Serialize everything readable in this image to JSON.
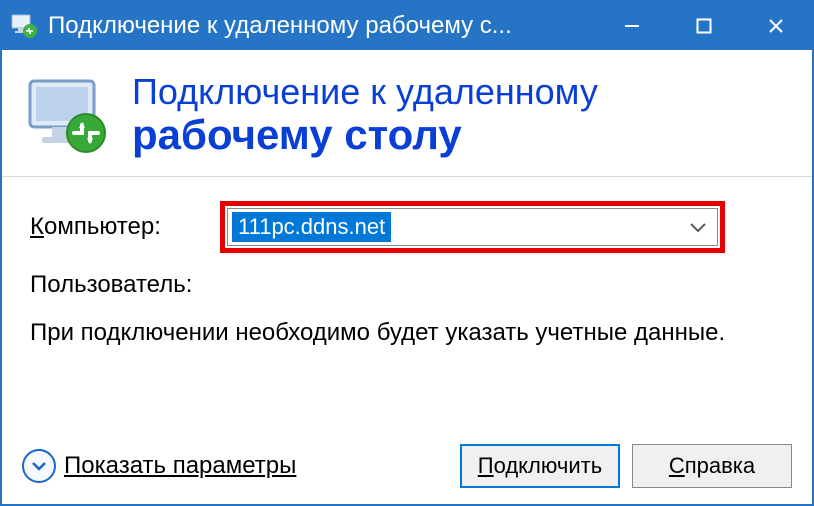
{
  "titlebar": {
    "title": "Подключение к удаленному рабочему с..."
  },
  "header": {
    "line1": "Подключение к удаленному",
    "line2": "рабочему столу"
  },
  "form": {
    "computer_label_pre": "К",
    "computer_label_rest": "омпьютер:",
    "computer_value": "111pc.ddns.net",
    "user_label": "Пользователь:",
    "user_value": "",
    "info": "При подключении необходимо будет указать учетные данные."
  },
  "footer": {
    "options_pre": "П",
    "options_rest": "оказать параметры",
    "connect_pre": "П",
    "connect_rest": "одключить",
    "help_pre": "С",
    "help_rest": "правка"
  }
}
